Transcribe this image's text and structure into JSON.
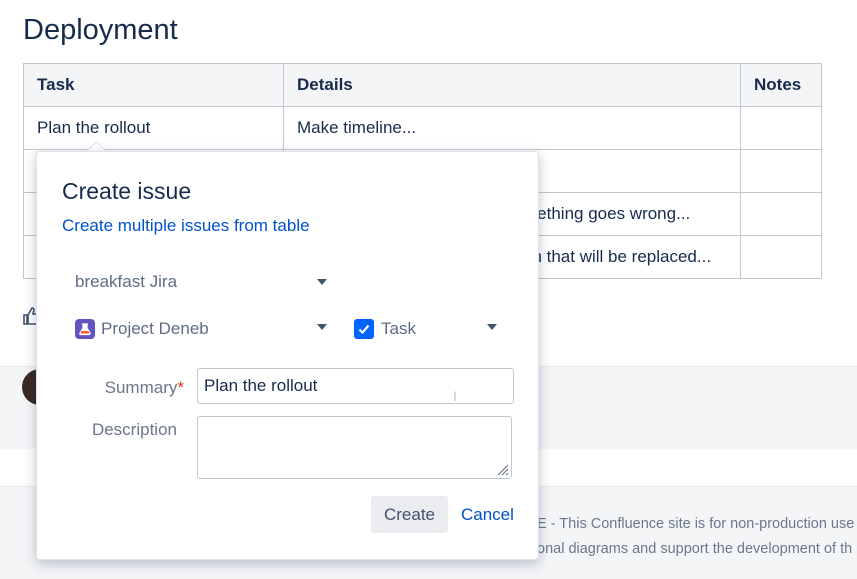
{
  "page": {
    "title": "Deployment"
  },
  "table": {
    "headers": [
      "Task",
      "Details",
      "Notes"
    ],
    "rows": [
      {
        "task": "Plan the rollout",
        "details": "Make timeline...",
        "notes": ""
      },
      {
        "task": "",
        "details": "",
        "notes": ""
      },
      {
        "task": "",
        "details": "mething goes wrong...",
        "notes": ""
      },
      {
        "task": "",
        "details": "on that will be replaced...",
        "notes": ""
      }
    ]
  },
  "footer": {
    "line1": "E - This Confluence site is for non-production use",
    "line2": "onal diagrams and support the development of th"
  },
  "dialog": {
    "title": "Create issue",
    "link": "Create multiple issues from table",
    "server_select": {
      "value": "breakfast Jira",
      "icon": "chevron-down-icon"
    },
    "project_select": {
      "value": "Project Deneb",
      "icon": "project-icon"
    },
    "issuetype_select": {
      "value": "Task",
      "icon": "task-checkbox-icon"
    },
    "summary": {
      "label": "Summary",
      "required_marker": "*",
      "value": "Plan the rollout"
    },
    "description": {
      "label": "Description",
      "value": ""
    },
    "buttons": {
      "create": "Create",
      "cancel": "Cancel"
    }
  },
  "colors": {
    "link": "#0052cc",
    "project_icon": "#6554c0",
    "checkbox": "#0065ff",
    "required": "#de350b"
  }
}
